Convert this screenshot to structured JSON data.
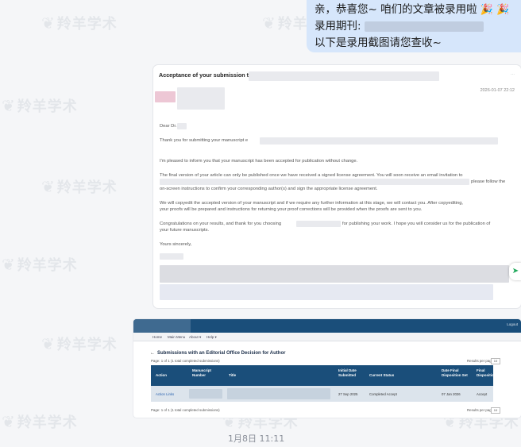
{
  "watermark": "羚羊学术",
  "chat": {
    "line1": "亲，恭喜您~ 咱们的文章被录用啦",
    "line1_emoji": "🎉 🎉",
    "line2_label": "录用期刊:",
    "line3": "以下是录用截图请您查收~",
    "timestamp": "1月8日 11:11"
  },
  "email": {
    "subject": "Acceptance of your submission to",
    "date": "2026-01-07 22:12",
    "greeting": "Dear Dr.",
    "thanks": "Thank you for submitting your manuscript e",
    "p1": "I'm pleased to inform you that your manuscript has been accepted for publication without change.",
    "p2a": "The final version of your article can only be published once we have received a signed license agreement. You will soon receive an email invitation to",
    "p2b": "please follow the",
    "p2c": "on-screen instructions to confirm your corresponding author(s) and sign the appropriate license agreement.",
    "p3a": "We will copyedit the accepted version of your manuscript and if we require any further information at this stage, we will contact you. After copyediting,",
    "p3b": "your proofs will be prepared and instructions for returning your proof corrections will be provided when the proofs are sent to you.",
    "p4a": "Congratulations on your results, and thank for you choosing",
    "p4b": "for publishing your work. I hope you will consider us for the publication of",
    "p4c": "your future manuscripts.",
    "signoff": "Yours sincerely,"
  },
  "system": {
    "login": "Logout",
    "nav": [
      "Home",
      "Main Menu",
      "About ▾",
      "Help ▾"
    ],
    "heading": "Submissions with an Editorial Office Decision for Author",
    "page_info": "Page: 1 of 1 (1 total completed submissions)",
    "results_label": "Results per page",
    "results_value": "10",
    "columns": [
      "Action",
      "Manuscript\nNumber",
      "Title",
      "Initial Date\nSubmitted",
      "Current Status",
      "Date Final\nDisposition Set",
      "Final\nDisposition"
    ],
    "row": {
      "action": "Action Links",
      "initial_date": "27 Sep 2025",
      "status": "Completed Accept",
      "final_date": "07 Jan 2026",
      "disposition": "Accept"
    }
  }
}
